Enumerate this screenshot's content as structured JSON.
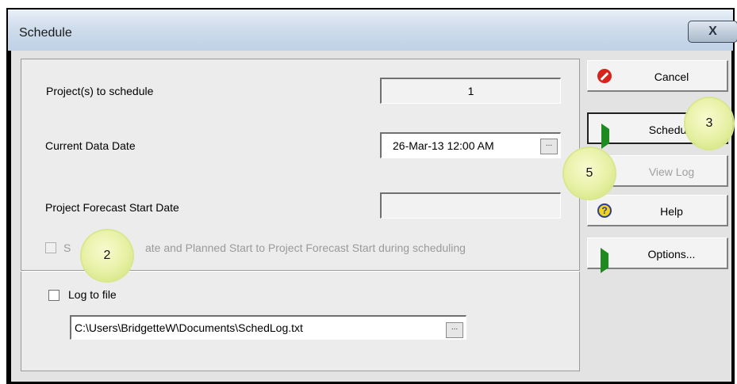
{
  "window": {
    "title": "Schedule",
    "close_label": "X"
  },
  "fields": {
    "projects_label": "Project(s) to schedule",
    "projects_value": "1",
    "data_date_label": "Current Data Date",
    "data_date_value": "26-Mar-13 12:00 AM",
    "browse_label": "...",
    "forecast_label": "Project Forecast Start Date",
    "forecast_value": "",
    "set_start_prefix": "S",
    "set_start_suffix": "ate and Planned Start to Project Forecast Start during scheduling",
    "log_label": "Log to file",
    "log_path": "C:\\Users\\BridgetteW\\Documents\\SchedLog.txt"
  },
  "buttons": {
    "cancel": "Cancel",
    "schedule": "Schedule",
    "view_log": "View Log",
    "help": "Help",
    "options": "Options...",
    "help_glyph": "?"
  },
  "callouts": {
    "c2": "2",
    "c3": "3",
    "c5": "5"
  },
  "colors": {
    "cancel_icon": "#d8231c",
    "play_icon": "#1f8a1f",
    "help_icon": "#f2d21a",
    "callout": "#e6f0a3"
  }
}
